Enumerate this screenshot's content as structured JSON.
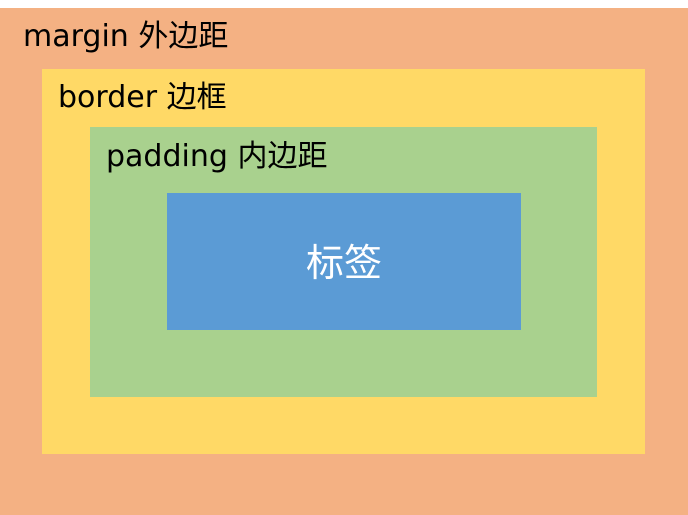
{
  "diagram": {
    "margin": {
      "label": "margin 外边距",
      "color": "#F4B183"
    },
    "border": {
      "label": "border 边框",
      "color": "#FFD966"
    },
    "padding": {
      "label": "padding 内边距",
      "color": "#A9D18E"
    },
    "content": {
      "label": "标签",
      "color": "#5B9BD5",
      "text_color": "#FFFFFF"
    }
  }
}
